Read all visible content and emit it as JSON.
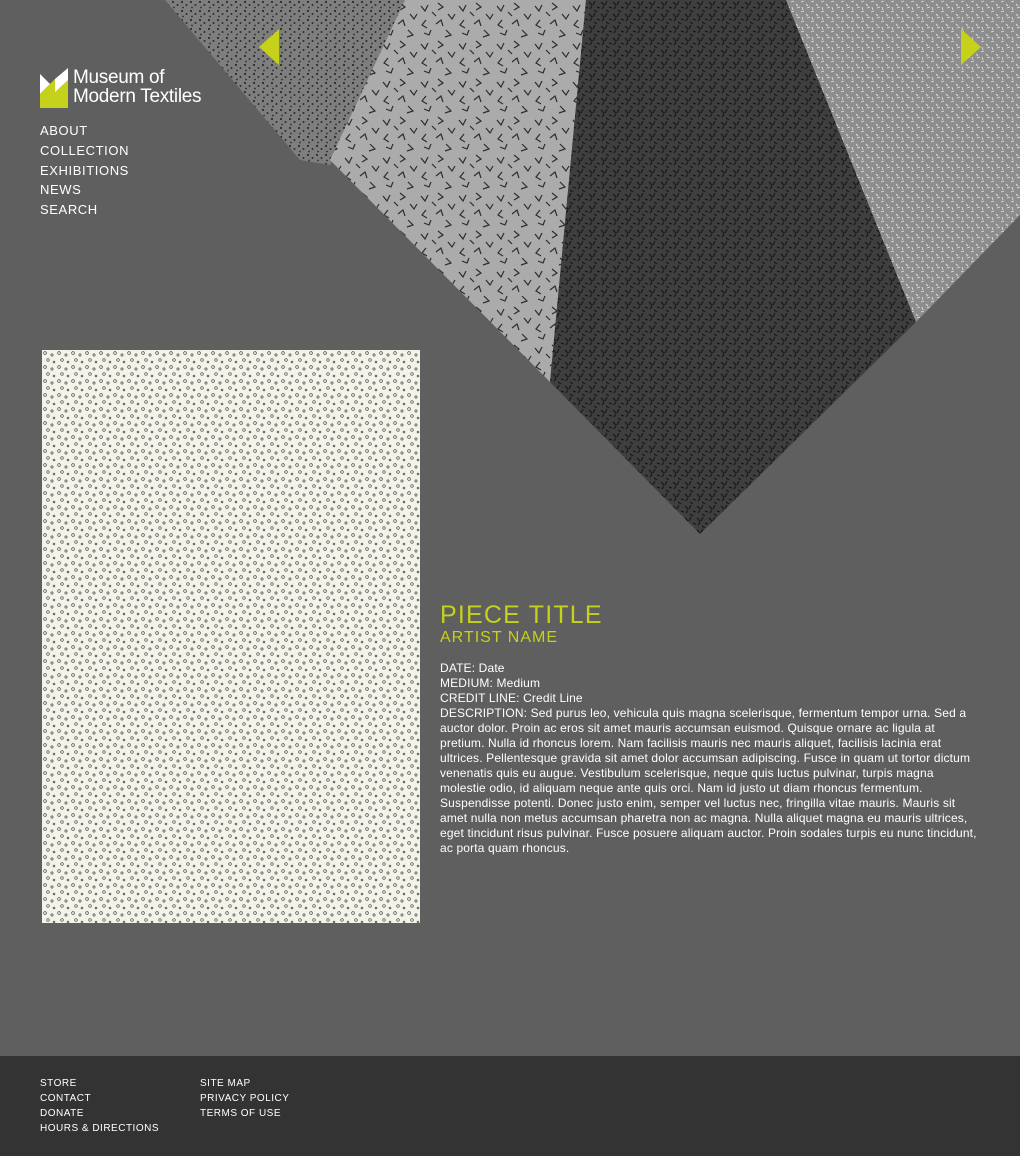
{
  "logo": {
    "line1": "Museum of",
    "line2": "Modern Textiles",
    "accent_color": "#c5d11b"
  },
  "nav": {
    "items": [
      "ABOUT",
      "COLLECTION",
      "EXHIBITIONS",
      "NEWS",
      "SEARCH"
    ]
  },
  "hero": {
    "prev_icon": "triangle-left-icon",
    "next_icon": "triangle-right-icon"
  },
  "piece": {
    "title": "PIECE TITLE",
    "artist": "ARTIST NAME",
    "date": "DATE: Date",
    "medium": "MEDIUM: Medium",
    "credit": "CREDIT LINE: Credit Line",
    "description": "DESCRIPTION: Sed purus leo, vehicula quis magna scelerisque, fermentum tempor urna. Sed a auctor dolor. Proin ac eros sit amet mauris accumsan euismod. Quisque ornare ac ligula at pretium. Nulla id rhoncus lorem. Nam facilisis mauris nec mauris aliquet, facilisis lacinia erat ultrices. Pellentesque gravida sit amet dolor accumsan adipiscing. Fusce in quam ut tortor dictum venenatis quis eu augue. Vestibulum scelerisque, neque quis luctus pulvinar, turpis magna molestie odio, id aliquam neque ante quis orci. Nam id justo ut diam rhoncus fermentum. Suspendisse potenti. Donec justo enim, semper vel luctus nec, fringilla vitae mauris. Mauris sit amet nulla non metus accumsan pharetra non ac magna. Nulla aliquet magna eu mauris ultrices, eget tincidunt risus pulvinar. Fusce posuere aliquam auctor. Proin sodales turpis eu nunc tincidunt, ac porta quam rhoncus."
  },
  "footer": {
    "col1": [
      "STORE",
      "CONTACT",
      "DONATE",
      "HOURS & DIRECTIONS"
    ],
    "col2": [
      "SITE MAP",
      "PRIVACY POLICY",
      "TERMS OF USE"
    ]
  },
  "colors": {
    "background": "#5f5f5f",
    "footer": "#333333",
    "accent": "#c5d11b",
    "textile_bg": "#f3f3ea"
  }
}
